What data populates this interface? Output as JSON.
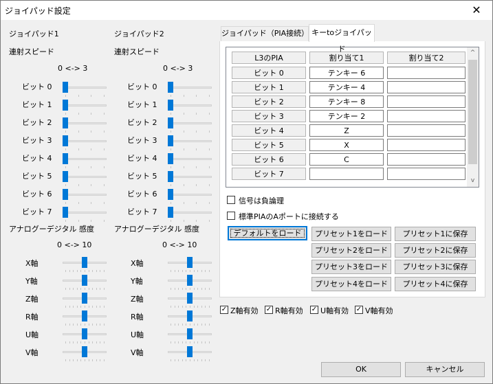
{
  "window": {
    "title": "ジョイパッド設定",
    "close_glyph": "✕"
  },
  "left_panels": [
    {
      "header": "ジョイパッド1",
      "rapid_label": "連射スピード",
      "rapid_range": "0 <-> 3",
      "bits": [
        "ビット 0",
        "ビット 1",
        "ビット 2",
        "ビット 3",
        "ビット 4",
        "ビット 5",
        "ビット 6",
        "ビット 7"
      ],
      "bit_values": [
        0,
        0,
        0,
        0,
        0,
        0,
        0,
        0
      ],
      "analog_label": "アナログーデジタル 感度",
      "analog_range": "0 <-> 10",
      "axes": [
        "X軸",
        "Y軸",
        "Z軸",
        "R軸",
        "U軸",
        "V軸"
      ],
      "axis_values": [
        5,
        5,
        5,
        5,
        5,
        5
      ]
    },
    {
      "header": "ジョイパッド2",
      "rapid_label": "連射スピード",
      "rapid_range": "0 <-> 3",
      "bits": [
        "ビット 0",
        "ビット 1",
        "ビット 2",
        "ビット 3",
        "ビット 4",
        "ビット 5",
        "ビット 6",
        "ビット 7"
      ],
      "bit_values": [
        0,
        0,
        0,
        0,
        0,
        0,
        0,
        0
      ],
      "analog_label": "アナログーデジタル 感度",
      "analog_range": "0 <-> 10",
      "axes": [
        "X軸",
        "Y軸",
        "Z軸",
        "R軸",
        "U軸",
        "V軸"
      ],
      "axis_values": [
        5,
        5,
        5,
        5,
        5,
        5
      ]
    }
  ],
  "tabs": [
    {
      "label": "ジョイパッド（PIA接続）",
      "active": false
    },
    {
      "label": "キーtoジョイパッド",
      "active": true
    }
  ],
  "grid": {
    "columns": [
      "L3のPIA",
      "割り当て1",
      "割り当て2"
    ],
    "rows": [
      {
        "name": "ビット 0",
        "a1": "テンキー 6",
        "a2": ""
      },
      {
        "name": "ビット 1",
        "a1": "テンキー 4",
        "a2": ""
      },
      {
        "name": "ビット 2",
        "a1": "テンキー 8",
        "a2": ""
      },
      {
        "name": "ビット 3",
        "a1": "テンキー 2",
        "a2": ""
      },
      {
        "name": "ビット 4",
        "a1": "Z",
        "a2": ""
      },
      {
        "name": "ビット 5",
        "a1": "X",
        "a2": ""
      },
      {
        "name": "ビット 6",
        "a1": "C",
        "a2": ""
      },
      {
        "name": "ビット 7",
        "a1": "",
        "a2": ""
      }
    ],
    "scroll_up": "^",
    "scroll_down": "v"
  },
  "options": {
    "negative_logic": {
      "label": "信号は負論理",
      "checked": false
    },
    "standard_pia": {
      "label": "標準PIAのAポートに接続する",
      "checked": false
    }
  },
  "preset_buttons": {
    "load_default": "デフォルトをロード",
    "load": [
      "プリセット1をロード",
      "プリセット2をロード",
      "プリセット3をロード",
      "プリセット4をロード"
    ],
    "save": [
      "プリセット1に保存",
      "プリセット2に保存",
      "プリセット3に保存",
      "プリセット4に保存"
    ]
  },
  "axis_enable": [
    {
      "label": "Z軸有効",
      "checked": true
    },
    {
      "label": "R軸有効",
      "checked": true
    },
    {
      "label": "U軸有効",
      "checked": true
    },
    {
      "label": "V軸有効",
      "checked": true
    }
  ],
  "check_glyph": "✓",
  "footer": {
    "ok": "OK",
    "cancel": "キャンセル"
  }
}
